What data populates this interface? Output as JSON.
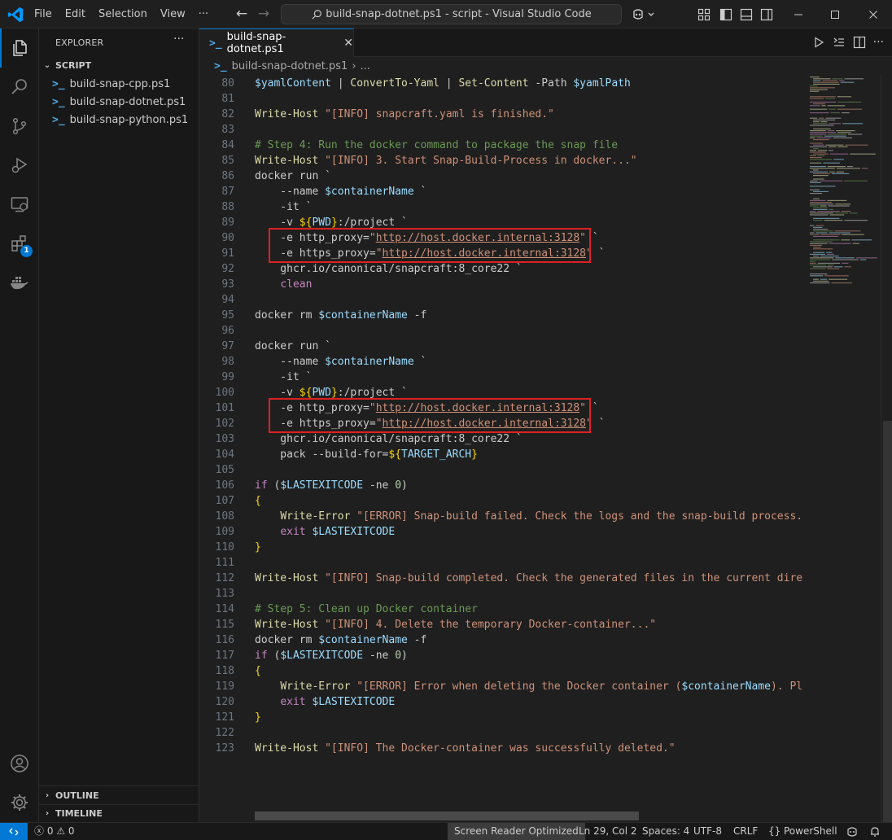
{
  "window": {
    "title": "build-snap-dotnet.ps1 - script - Visual Studio Code",
    "menu": [
      "File",
      "Edit",
      "Selection",
      "View",
      "···"
    ]
  },
  "sidebar": {
    "title": "EXPLORER",
    "more": "···",
    "folder": "SCRIPT",
    "files": [
      "build-snap-cpp.ps1",
      "build-snap-dotnet.ps1",
      "build-snap-python.ps1"
    ],
    "outline": "OUTLINE",
    "timeline": "TIMELINE"
  },
  "activity": {
    "extensions_badge": "1"
  },
  "editor": {
    "tab_label": "build-snap-dotnet.ps1",
    "breadcrumb_file": "build-snap-dotnet.ps1",
    "breadcrumb_more": "..."
  },
  "code_lines": [
    {
      "n": "80",
      "tokens": [
        [
          "var",
          "$yamlContent"
        ],
        [
          "pun",
          " | "
        ],
        [
          "fn",
          "ConvertTo-Yaml"
        ],
        [
          "pun",
          " | "
        ],
        [
          "fn",
          "Set-Content"
        ],
        [
          "pun",
          " -Path "
        ],
        [
          "var",
          "$yamlPath"
        ]
      ]
    },
    {
      "n": "81",
      "tokens": []
    },
    {
      "n": "82",
      "tokens": [
        [
          "fn",
          "Write-Host"
        ],
        [
          "pun",
          " "
        ],
        [
          "str",
          "\"[INFO] snapcraft.yaml is finished.\""
        ]
      ]
    },
    {
      "n": "83",
      "tokens": []
    },
    {
      "n": "84",
      "tokens": [
        [
          "cmt",
          "# Step 4: Run the docker command to package the snap file"
        ]
      ]
    },
    {
      "n": "85",
      "tokens": [
        [
          "fn",
          "Write-Host"
        ],
        [
          "pun",
          " "
        ],
        [
          "str",
          "\"[INFO] 3. Start Snap-Build-Process in docker...\""
        ]
      ]
    },
    {
      "n": "86",
      "tokens": [
        [
          "pun",
          "docker run `"
        ]
      ]
    },
    {
      "n": "87",
      "tokens": [
        [
          "pun",
          "    --name "
        ],
        [
          "var",
          "$containerName"
        ],
        [
          "pun",
          " `"
        ]
      ]
    },
    {
      "n": "88",
      "tokens": [
        [
          "pun",
          "    -it `"
        ]
      ]
    },
    {
      "n": "89",
      "tokens": [
        [
          "pun",
          "    -v "
        ],
        [
          "brace",
          "${"
        ],
        [
          "var",
          "PWD"
        ],
        [
          "brace",
          "}"
        ],
        [
          "pun",
          ":/project `"
        ]
      ]
    },
    {
      "n": "90",
      "tokens": [
        [
          "pun",
          "    -e http_proxy="
        ],
        [
          "str",
          "\""
        ],
        [
          "url",
          "http://host.docker.internal:3128"
        ],
        [
          "str",
          "\""
        ],
        [
          "pun",
          " `"
        ]
      ]
    },
    {
      "n": "91",
      "tokens": [
        [
          "pun",
          "    -e https_proxy="
        ],
        [
          "str",
          "\""
        ],
        [
          "url",
          "http://host.docker.internal:3128"
        ],
        [
          "str",
          "\""
        ],
        [
          "pun",
          " `"
        ]
      ]
    },
    {
      "n": "92",
      "tokens": [
        [
          "pun",
          "    ghcr.io/canonical/snapcraft:8_core22 `"
        ]
      ]
    },
    {
      "n": "93",
      "tokens": [
        [
          "pun",
          "    "
        ],
        [
          "kw",
          "clean"
        ]
      ]
    },
    {
      "n": "94",
      "tokens": []
    },
    {
      "n": "95",
      "tokens": [
        [
          "pun",
          "docker rm "
        ],
        [
          "var",
          "$containerName"
        ],
        [
          "pun",
          " -f"
        ]
      ]
    },
    {
      "n": "96",
      "tokens": []
    },
    {
      "n": "97",
      "tokens": [
        [
          "pun",
          "docker run `"
        ]
      ]
    },
    {
      "n": "98",
      "tokens": [
        [
          "pun",
          "    --name "
        ],
        [
          "var",
          "$containerName"
        ],
        [
          "pun",
          " `"
        ]
      ]
    },
    {
      "n": "99",
      "tokens": [
        [
          "pun",
          "    -it `"
        ]
      ]
    },
    {
      "n": "100",
      "tokens": [
        [
          "pun",
          "    -v "
        ],
        [
          "brace",
          "${"
        ],
        [
          "var",
          "PWD"
        ],
        [
          "brace",
          "}"
        ],
        [
          "pun",
          ":/project `"
        ]
      ]
    },
    {
      "n": "101",
      "tokens": [
        [
          "pun",
          "    -e http_proxy="
        ],
        [
          "str",
          "\""
        ],
        [
          "url",
          "http://host.docker.internal:3128"
        ],
        [
          "str",
          "\""
        ],
        [
          "pun",
          " `"
        ]
      ]
    },
    {
      "n": "102",
      "tokens": [
        [
          "pun",
          "    -e https_proxy="
        ],
        [
          "str",
          "\""
        ],
        [
          "url",
          "http://host.docker.internal:3128"
        ],
        [
          "str",
          "\""
        ],
        [
          "pun",
          " `"
        ]
      ]
    },
    {
      "n": "103",
      "tokens": [
        [
          "pun",
          "    ghcr.io/canonical/snapcraft:8_core22 `"
        ]
      ]
    },
    {
      "n": "104",
      "tokens": [
        [
          "pun",
          "    pack --build-for="
        ],
        [
          "brace",
          "${"
        ],
        [
          "var",
          "TARGET_ARCH"
        ],
        [
          "brace",
          "}"
        ]
      ]
    },
    {
      "n": "105",
      "tokens": []
    },
    {
      "n": "106",
      "tokens": [
        [
          "kw",
          "if"
        ],
        [
          "pun",
          " ("
        ],
        [
          "var",
          "$LASTEXITCODE"
        ],
        [
          "pun",
          " -ne "
        ],
        [
          "num",
          "0"
        ],
        [
          "pun",
          ")"
        ]
      ]
    },
    {
      "n": "107",
      "tokens": [
        [
          "brace",
          "{"
        ]
      ]
    },
    {
      "n": "108",
      "tokens": [
        [
          "pun",
          "    "
        ],
        [
          "fn",
          "Write-Error"
        ],
        [
          "pun",
          " "
        ],
        [
          "str",
          "\"[ERROR] Snap-build failed. Check the logs and the snap-build process.\""
        ]
      ]
    },
    {
      "n": "109",
      "tokens": [
        [
          "pun",
          "    "
        ],
        [
          "kw",
          "exit"
        ],
        [
          "pun",
          " "
        ],
        [
          "var",
          "$LASTEXITCODE"
        ]
      ]
    },
    {
      "n": "110",
      "tokens": [
        [
          "brace",
          "}"
        ]
      ]
    },
    {
      "n": "111",
      "tokens": []
    },
    {
      "n": "112",
      "tokens": [
        [
          "fn",
          "Write-Host"
        ],
        [
          "pun",
          " "
        ],
        [
          "str",
          "\"[INFO] Snap-build completed. Check the generated files in the current direct"
        ]
      ]
    },
    {
      "n": "113",
      "tokens": []
    },
    {
      "n": "114",
      "tokens": [
        [
          "cmt",
          "# Step 5: Clean up Docker container"
        ]
      ]
    },
    {
      "n": "115",
      "tokens": [
        [
          "fn",
          "Write-Host"
        ],
        [
          "pun",
          " "
        ],
        [
          "str",
          "\"[INFO] 4. Delete the temporary Docker-container...\""
        ]
      ]
    },
    {
      "n": "116",
      "tokens": [
        [
          "pun",
          "docker rm "
        ],
        [
          "var",
          "$containerName"
        ],
        [
          "pun",
          " -f"
        ]
      ]
    },
    {
      "n": "117",
      "tokens": [
        [
          "kw",
          "if"
        ],
        [
          "pun",
          " ("
        ],
        [
          "var",
          "$LASTEXITCODE"
        ],
        [
          "pun",
          " -ne "
        ],
        [
          "num",
          "0"
        ],
        [
          "pun",
          ")"
        ]
      ]
    },
    {
      "n": "118",
      "tokens": [
        [
          "brace",
          "{"
        ]
      ]
    },
    {
      "n": "119",
      "tokens": [
        [
          "pun",
          "    "
        ],
        [
          "fn",
          "Write-Error"
        ],
        [
          "pun",
          " "
        ],
        [
          "str",
          "\"[ERROR] Error when deleting the Docker container ("
        ],
        [
          "var",
          "$containerName"
        ],
        [
          "str",
          "). Plea"
        ]
      ]
    },
    {
      "n": "120",
      "tokens": [
        [
          "pun",
          "    "
        ],
        [
          "kw",
          "exit"
        ],
        [
          "pun",
          " "
        ],
        [
          "var",
          "$LASTEXITCODE"
        ]
      ]
    },
    {
      "n": "121",
      "tokens": [
        [
          "brace",
          "}"
        ]
      ]
    },
    {
      "n": "122",
      "tokens": []
    },
    {
      "n": "123",
      "tokens": [
        [
          "fn",
          "Write-Host"
        ],
        [
          "pun",
          " "
        ],
        [
          "str",
          "\"[INFO] The Docker-container was successfully deleted.\""
        ]
      ]
    }
  ],
  "status": {
    "errors": "0",
    "warnings": "0",
    "screen_reader": "Screen Reader Optimized",
    "position": "Ln 29, Col 2",
    "spaces": "Spaces: 4",
    "encoding": "UTF-8",
    "eol": "CRLF",
    "braces": "{}",
    "language": "PowerShell"
  },
  "colors": {
    "accent": "#0078d4",
    "highlight_box": "#e02020"
  }
}
